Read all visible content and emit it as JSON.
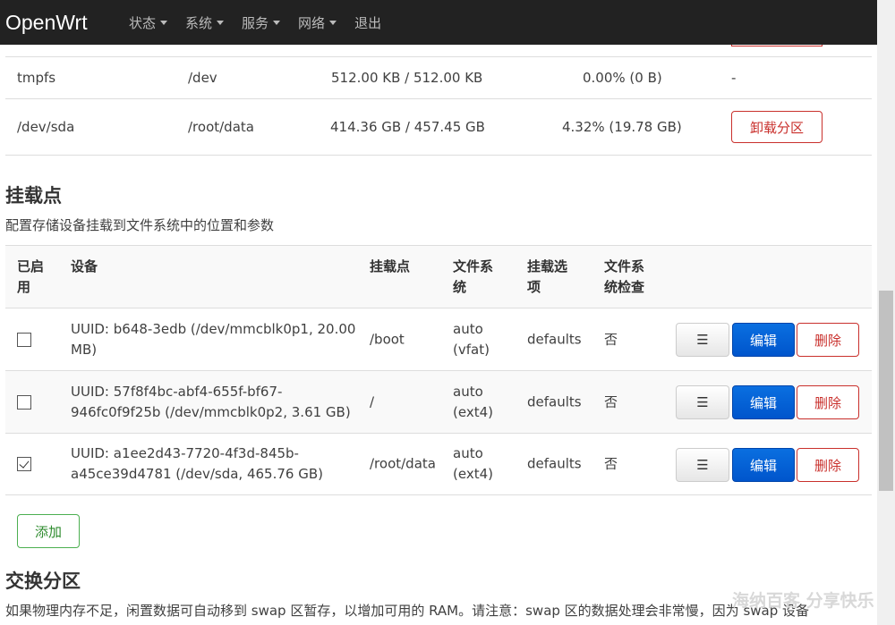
{
  "navbar": {
    "brand": "OpenWrt",
    "items": [
      {
        "label": "状态",
        "dropdown": true
      },
      {
        "label": "系统",
        "dropdown": true
      },
      {
        "label": "服务",
        "dropdown": true
      },
      {
        "label": "网络",
        "dropdown": true
      },
      {
        "label": "退出",
        "dropdown": false
      }
    ]
  },
  "mounted": {
    "rows": [
      {
        "filesystem": "tmpfs",
        "mountpoint": "/dev",
        "size": "512.00 KB / 512.00 KB",
        "used": "0.00% (0 B)",
        "action": "-"
      },
      {
        "filesystem": "/dev/sda",
        "mountpoint": "/root/data",
        "size": "414.36 GB / 457.45 GB",
        "used": "4.32% (19.78 GB)",
        "action": "卸载分区"
      }
    ]
  },
  "mountpoints": {
    "title": "挂载点",
    "description": "配置存储设备挂载到文件系统中的位置和参数",
    "headers": {
      "enabled_l1": "已启",
      "enabled_l2": "用",
      "device": "设备",
      "mountpoint": "挂载点",
      "fs_l1": "文件系",
      "fs_l2": "统",
      "options_l1": "挂载选",
      "options_l2": "项",
      "fsck_l1": "文件系",
      "fsck_l2": "统检查"
    },
    "rows": [
      {
        "enabled": false,
        "device_l1": "UUID: b648-3edb (/dev/mmcblk0p1, 20.00",
        "device_l2": "MB)",
        "mountpoint": "/boot",
        "fs_l1": "auto",
        "fs_l2": "(vfat)",
        "options": "defaults",
        "fsck": "否"
      },
      {
        "enabled": false,
        "device_l1": "UUID: 57f8f4bc-abf4-655f-bf67-",
        "device_l2": "946fc0f9f25b (/dev/mmcblk0p2, 3.61 GB)",
        "mountpoint": "/",
        "fs_l1": "auto",
        "fs_l2": "(ext4)",
        "options": "defaults",
        "fsck": "否"
      },
      {
        "enabled": true,
        "device_l1": "UUID: a1ee2d43-7720-4f3d-845b-",
        "device_l2": "a45ce39d4781 (/dev/sda, 465.76 GB)",
        "mountpoint": "/root/data",
        "fs_l1": "auto",
        "fs_l2": "(ext4)",
        "options": "defaults",
        "fsck": "否"
      }
    ],
    "buttons": {
      "menu": "☰",
      "edit": "编辑",
      "delete": "删除"
    },
    "add_label": "添加"
  },
  "swap": {
    "title": "交换分区",
    "description": "如果物理内存不足，闲置数据可自动移到 swap 区暂存，以增加可用的 RAM。请注意：swap 区的数据处理会非常慢，因为 swap 设备"
  },
  "watermark": "海纳百客 分享快乐",
  "colors": {
    "navbar": "#222222",
    "primary": "#0055cc",
    "danger": "#c9302c",
    "success": "#4caf50"
  }
}
